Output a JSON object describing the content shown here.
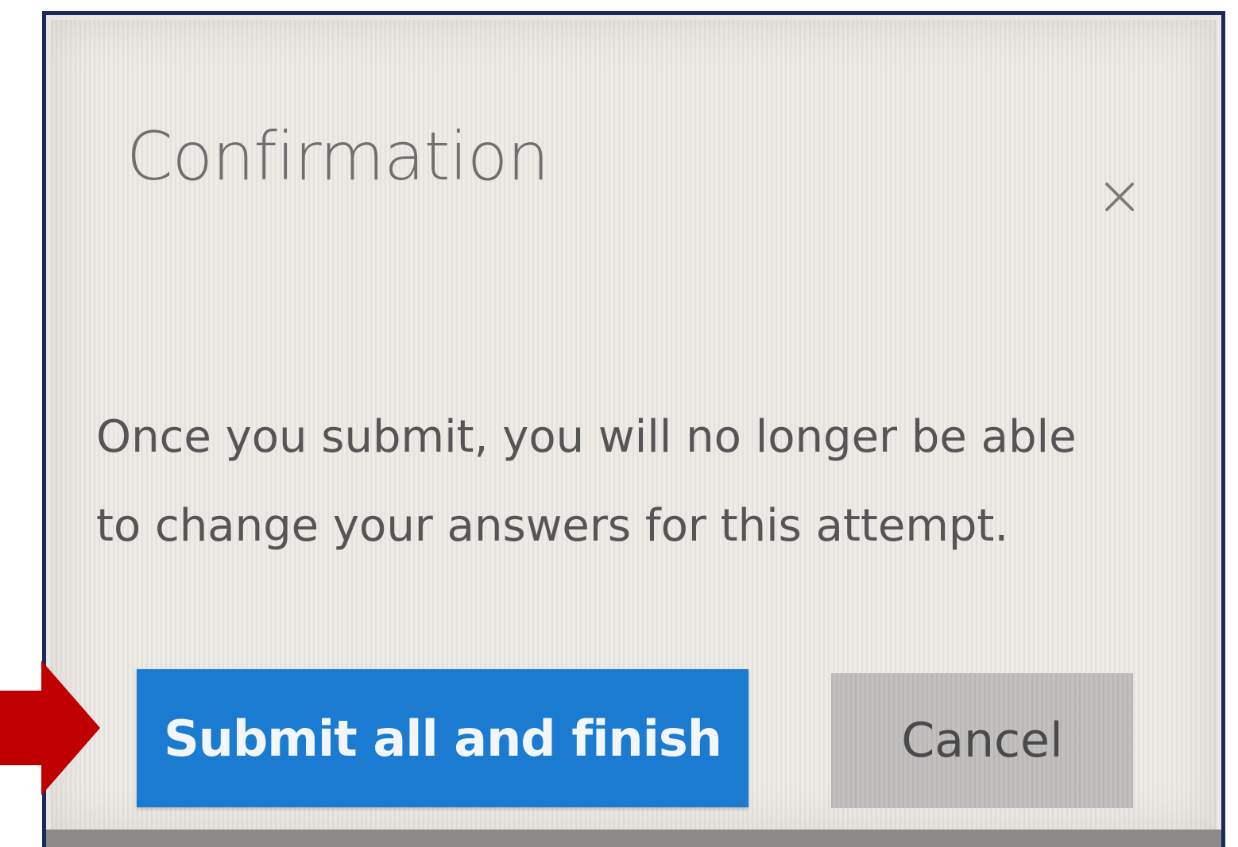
{
  "dialog": {
    "title": "Confirmation",
    "close_icon": "close-icon",
    "message": "Once you submit, you will no longer be able to change your answers for this attempt.",
    "primary_button": "Submit all and finish",
    "secondary_button": "Cancel"
  },
  "annotation": {
    "icon": "arrow-right-icon",
    "color": "#c00000"
  },
  "colors": {
    "primary": "#1a7bd0",
    "frame_border": "#1d2a57",
    "cancel_bg": "#c2c0bf"
  }
}
